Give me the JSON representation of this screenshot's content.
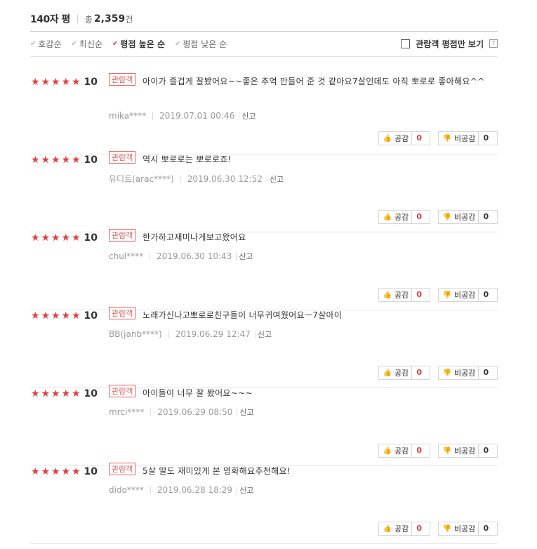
{
  "header": {
    "title": "140자 평",
    "total_prefix": "총",
    "total_count": "2,359",
    "total_suffix": "건"
  },
  "sort": {
    "items": [
      {
        "label": "호감순",
        "active": false
      },
      {
        "label": "최신순",
        "active": false
      },
      {
        "label": "평점 높은 순",
        "active": true
      },
      {
        "label": "평점 낮은 순",
        "active": false
      }
    ],
    "filter_label": "관람객 평점만 보기",
    "help_label": "?"
  },
  "labels": {
    "audience_badge": "관람객",
    "report": "신고",
    "like": "공감",
    "dislike": "비공감"
  },
  "colors": {
    "star": "#e53b3b",
    "badge": "#e45c5c",
    "like_count": "#e03c3c"
  },
  "reviews": [
    {
      "stars": 5,
      "score": "10",
      "text": "아이가 즐겁게 잘봤어요~~좋은 추억 만들어 준 것 같아요7살인데도 아직 뽀로로 좋아해요^^",
      "user": "mika****",
      "date": "2019.07.01 00:46",
      "likes": "0",
      "dislikes": "0"
    },
    {
      "stars": 5,
      "score": "10",
      "text": "역시 뽀로로는 뽀로로죠!",
      "user": "유디트(arac****)",
      "date": "2019.06.30 12:52",
      "likes": "0",
      "dislikes": "0"
    },
    {
      "stars": 5,
      "score": "10",
      "text": "한가하고재미나게보고왔어요",
      "user": "chul****",
      "date": "2019.06.30 10:43",
      "likes": "0",
      "dislikes": "0"
    },
    {
      "stars": 5,
      "score": "10",
      "text": "노래가신나고뽀로로친구들이 너무귀여웠어요ㅡ7살아이",
      "user": "BB(janb****)",
      "date": "2019.06.29 12:47",
      "likes": "0",
      "dislikes": "0"
    },
    {
      "stars": 5,
      "score": "10",
      "text": "아이들이 너무 잘 봤어요~~~",
      "user": "mrci****",
      "date": "2019.06.29 08:50",
      "likes": "0",
      "dislikes": "0"
    },
    {
      "stars": 5,
      "score": "10",
      "text": "5살 딸도 재미있게 본 영화해요추천해요!",
      "user": "dido****",
      "date": "2019.06.28 18:29",
      "likes": "0",
      "dislikes": "0"
    }
  ]
}
